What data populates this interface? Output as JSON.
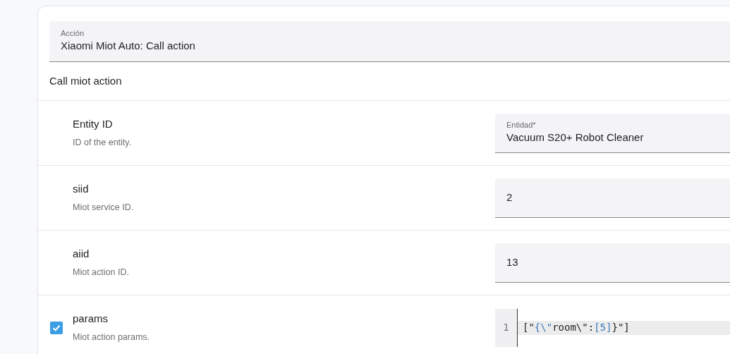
{
  "action_field": {
    "label": "Acción",
    "value": "Xiaomi Miot Auto: Call action"
  },
  "description": "Call miot action",
  "rows": [
    {
      "kind": "field",
      "name": "Entity ID",
      "description": "ID of the entity.",
      "label": "Entidad*",
      "value": "Vacuum S20+ Robot Cleaner"
    },
    {
      "kind": "field",
      "name": "siid",
      "description": "Miot service ID.",
      "value": "2"
    },
    {
      "kind": "field",
      "name": "aiid",
      "description": "Miot action ID.",
      "value": "13"
    },
    {
      "kind": "code",
      "name": "params",
      "description": "Miot action params.",
      "checked": true,
      "line_number": "1",
      "tokens": [
        {
          "text": "[\"",
          "kind": "plain"
        },
        {
          "text": "{\\\"",
          "kind": "accent"
        },
        {
          "text": "room\\\"",
          "kind": "plain"
        },
        {
          "text": ":",
          "kind": "plain"
        },
        {
          "text": "[5]",
          "kind": "accent"
        },
        {
          "text": "}\"]",
          "kind": "plain"
        }
      ]
    }
  ]
}
